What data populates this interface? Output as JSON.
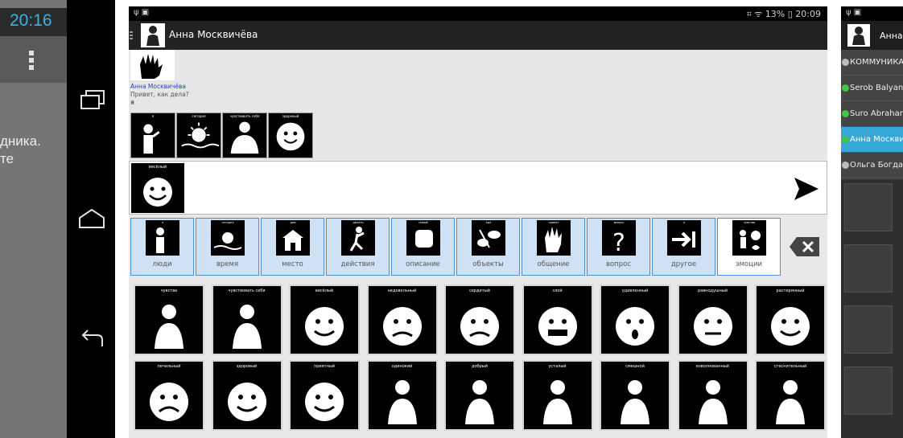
{
  "left_phone": {
    "time": "20:16",
    "text_line1": "дника.",
    "text_line2": "те"
  },
  "status_bar": {
    "left_icons": "ψ ▣",
    "right": "⌗ ᯤ 13% ▯ 20:09"
  },
  "action_bar": {
    "title": "Анна Москвичёва"
  },
  "chat": {
    "message_author": "Анна Москвичёва",
    "message_text": "Привет, как дела?",
    "message_word": "я",
    "message_tiles": [
      "я",
      "сегодня",
      "чувствовать себя",
      "здоровый"
    ]
  },
  "compose": {
    "tile_label": "весёлый"
  },
  "categories": [
    {
      "label": "люди",
      "small": "я"
    },
    {
      "label": "время",
      "small": "сегодня"
    },
    {
      "label": "место",
      "small": "дом"
    },
    {
      "label": "действия",
      "small": "делать"
    },
    {
      "label": "описание",
      "small": "новый"
    },
    {
      "label": "объекты",
      "small": "еда"
    },
    {
      "label": "общение",
      "small": "привет"
    },
    {
      "label": "вопрос",
      "small": "вопрос"
    },
    {
      "label": "другое",
      "small": "к"
    },
    {
      "label": "эмоции",
      "small": "чувства"
    }
  ],
  "grid_row1": [
    "чувства",
    "чувствовать себя",
    "весёлый",
    "недовольный",
    "сердитый",
    "злой",
    "удивленный",
    "равнодушный",
    "растерянный"
  ],
  "grid_row2": [
    "печальный",
    "здоровый",
    "приятный",
    "одинокий",
    "добрый",
    "усталый",
    "смешной",
    "взволнованный",
    "стеснительный"
  ],
  "right_phone": {
    "status_left": "ψ ▣",
    "title": "Анна",
    "contacts": [
      {
        "name": "КОММУНИКАЦИЯ",
        "status": "grey"
      },
      {
        "name": "Serob Balyan",
        "status": "green"
      },
      {
        "name": "Suro Abrahamyan",
        "status": "green"
      },
      {
        "name": "Анна Москвичёва",
        "status": "green"
      },
      {
        "name": "Ольга Богданова",
        "status": "grey"
      }
    ]
  },
  "colors": {
    "accent_blue": "#33b5e5",
    "selected_contact": "#35a7d8",
    "category_tint": "#cfe1f5",
    "category_border": "#4a90d9",
    "author_blue": "#2742c8"
  }
}
